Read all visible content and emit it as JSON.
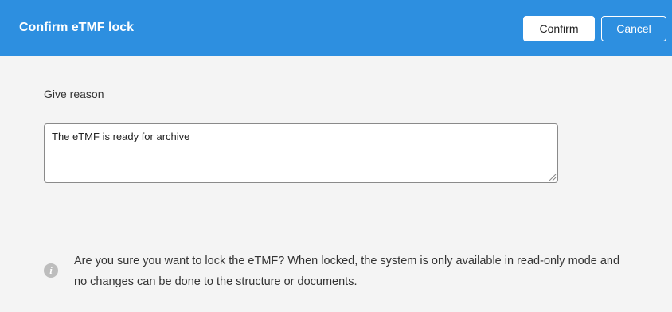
{
  "dialog": {
    "title": "Confirm eTMF lock",
    "confirm_label": "Confirm",
    "cancel_label": "Cancel"
  },
  "form": {
    "reason_label": "Give reason",
    "reason_value": "The eTMF is ready for archive"
  },
  "notice": {
    "icon": "info-icon",
    "text": "Are you sure you want to lock the eTMF? When locked, the system is only available in read-only mode and no changes can be done to the structure or documents."
  },
  "colors": {
    "header": "#2d8fe0",
    "background": "#f4f4f4"
  }
}
